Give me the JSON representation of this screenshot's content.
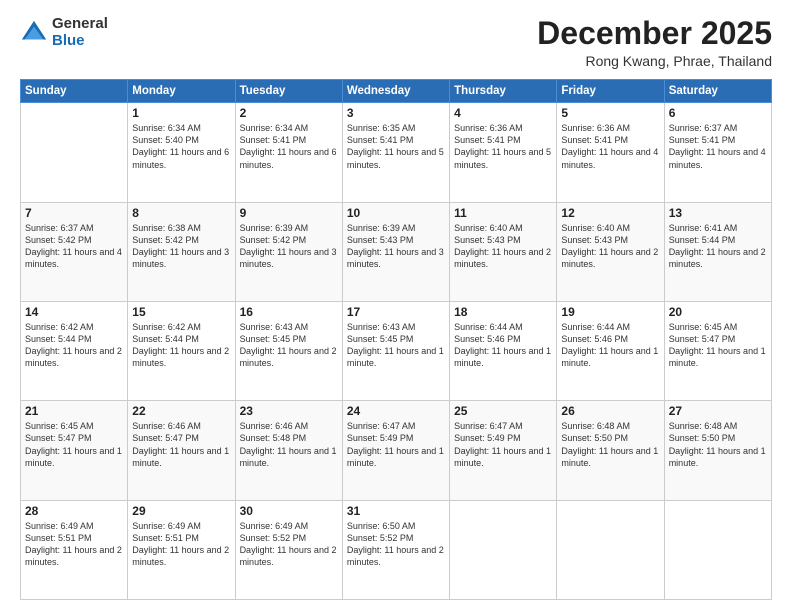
{
  "header": {
    "logo_general": "General",
    "logo_blue": "Blue",
    "month_title": "December 2025",
    "location": "Rong Kwang, Phrae, Thailand"
  },
  "weekdays": [
    "Sunday",
    "Monday",
    "Tuesday",
    "Wednesday",
    "Thursday",
    "Friday",
    "Saturday"
  ],
  "weeks": [
    [
      {
        "day": "",
        "sunrise": "",
        "sunset": "",
        "daylight": ""
      },
      {
        "day": "1",
        "sunrise": "Sunrise: 6:34 AM",
        "sunset": "Sunset: 5:40 PM",
        "daylight": "Daylight: 11 hours and 6 minutes."
      },
      {
        "day": "2",
        "sunrise": "Sunrise: 6:34 AM",
        "sunset": "Sunset: 5:41 PM",
        "daylight": "Daylight: 11 hours and 6 minutes."
      },
      {
        "day": "3",
        "sunrise": "Sunrise: 6:35 AM",
        "sunset": "Sunset: 5:41 PM",
        "daylight": "Daylight: 11 hours and 5 minutes."
      },
      {
        "day": "4",
        "sunrise": "Sunrise: 6:36 AM",
        "sunset": "Sunset: 5:41 PM",
        "daylight": "Daylight: 11 hours and 5 minutes."
      },
      {
        "day": "5",
        "sunrise": "Sunrise: 6:36 AM",
        "sunset": "Sunset: 5:41 PM",
        "daylight": "Daylight: 11 hours and 4 minutes."
      },
      {
        "day": "6",
        "sunrise": "Sunrise: 6:37 AM",
        "sunset": "Sunset: 5:41 PM",
        "daylight": "Daylight: 11 hours and 4 minutes."
      }
    ],
    [
      {
        "day": "7",
        "sunrise": "Sunrise: 6:37 AM",
        "sunset": "Sunset: 5:42 PM",
        "daylight": "Daylight: 11 hours and 4 minutes."
      },
      {
        "day": "8",
        "sunrise": "Sunrise: 6:38 AM",
        "sunset": "Sunset: 5:42 PM",
        "daylight": "Daylight: 11 hours and 3 minutes."
      },
      {
        "day": "9",
        "sunrise": "Sunrise: 6:39 AM",
        "sunset": "Sunset: 5:42 PM",
        "daylight": "Daylight: 11 hours and 3 minutes."
      },
      {
        "day": "10",
        "sunrise": "Sunrise: 6:39 AM",
        "sunset": "Sunset: 5:43 PM",
        "daylight": "Daylight: 11 hours and 3 minutes."
      },
      {
        "day": "11",
        "sunrise": "Sunrise: 6:40 AM",
        "sunset": "Sunset: 5:43 PM",
        "daylight": "Daylight: 11 hours and 2 minutes."
      },
      {
        "day": "12",
        "sunrise": "Sunrise: 6:40 AM",
        "sunset": "Sunset: 5:43 PM",
        "daylight": "Daylight: 11 hours and 2 minutes."
      },
      {
        "day": "13",
        "sunrise": "Sunrise: 6:41 AM",
        "sunset": "Sunset: 5:44 PM",
        "daylight": "Daylight: 11 hours and 2 minutes."
      }
    ],
    [
      {
        "day": "14",
        "sunrise": "Sunrise: 6:42 AM",
        "sunset": "Sunset: 5:44 PM",
        "daylight": "Daylight: 11 hours and 2 minutes."
      },
      {
        "day": "15",
        "sunrise": "Sunrise: 6:42 AM",
        "sunset": "Sunset: 5:44 PM",
        "daylight": "Daylight: 11 hours and 2 minutes."
      },
      {
        "day": "16",
        "sunrise": "Sunrise: 6:43 AM",
        "sunset": "Sunset: 5:45 PM",
        "daylight": "Daylight: 11 hours and 2 minutes."
      },
      {
        "day": "17",
        "sunrise": "Sunrise: 6:43 AM",
        "sunset": "Sunset: 5:45 PM",
        "daylight": "Daylight: 11 hours and 1 minute."
      },
      {
        "day": "18",
        "sunrise": "Sunrise: 6:44 AM",
        "sunset": "Sunset: 5:46 PM",
        "daylight": "Daylight: 11 hours and 1 minute."
      },
      {
        "day": "19",
        "sunrise": "Sunrise: 6:44 AM",
        "sunset": "Sunset: 5:46 PM",
        "daylight": "Daylight: 11 hours and 1 minute."
      },
      {
        "day": "20",
        "sunrise": "Sunrise: 6:45 AM",
        "sunset": "Sunset: 5:47 PM",
        "daylight": "Daylight: 11 hours and 1 minute."
      }
    ],
    [
      {
        "day": "21",
        "sunrise": "Sunrise: 6:45 AM",
        "sunset": "Sunset: 5:47 PM",
        "daylight": "Daylight: 11 hours and 1 minute."
      },
      {
        "day": "22",
        "sunrise": "Sunrise: 6:46 AM",
        "sunset": "Sunset: 5:47 PM",
        "daylight": "Daylight: 11 hours and 1 minute."
      },
      {
        "day": "23",
        "sunrise": "Sunrise: 6:46 AM",
        "sunset": "Sunset: 5:48 PM",
        "daylight": "Daylight: 11 hours and 1 minute."
      },
      {
        "day": "24",
        "sunrise": "Sunrise: 6:47 AM",
        "sunset": "Sunset: 5:49 PM",
        "daylight": "Daylight: 11 hours and 1 minute."
      },
      {
        "day": "25",
        "sunrise": "Sunrise: 6:47 AM",
        "sunset": "Sunset: 5:49 PM",
        "daylight": "Daylight: 11 hours and 1 minute."
      },
      {
        "day": "26",
        "sunrise": "Sunrise: 6:48 AM",
        "sunset": "Sunset: 5:50 PM",
        "daylight": "Daylight: 11 hours and 1 minute."
      },
      {
        "day": "27",
        "sunrise": "Sunrise: 6:48 AM",
        "sunset": "Sunset: 5:50 PM",
        "daylight": "Daylight: 11 hours and 1 minute."
      }
    ],
    [
      {
        "day": "28",
        "sunrise": "Sunrise: 6:49 AM",
        "sunset": "Sunset: 5:51 PM",
        "daylight": "Daylight: 11 hours and 2 minutes."
      },
      {
        "day": "29",
        "sunrise": "Sunrise: 6:49 AM",
        "sunset": "Sunset: 5:51 PM",
        "daylight": "Daylight: 11 hours and 2 minutes."
      },
      {
        "day": "30",
        "sunrise": "Sunrise: 6:49 AM",
        "sunset": "Sunset: 5:52 PM",
        "daylight": "Daylight: 11 hours and 2 minutes."
      },
      {
        "day": "31",
        "sunrise": "Sunrise: 6:50 AM",
        "sunset": "Sunset: 5:52 PM",
        "daylight": "Daylight: 11 hours and 2 minutes."
      },
      {
        "day": "",
        "sunrise": "",
        "sunset": "",
        "daylight": ""
      },
      {
        "day": "",
        "sunrise": "",
        "sunset": "",
        "daylight": ""
      },
      {
        "day": "",
        "sunrise": "",
        "sunset": "",
        "daylight": ""
      }
    ]
  ]
}
